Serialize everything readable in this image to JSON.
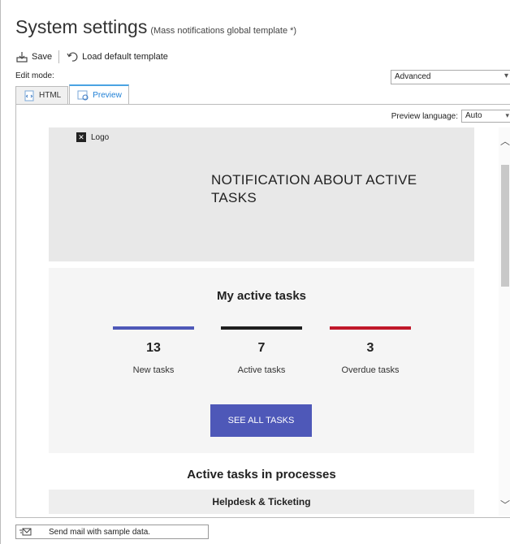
{
  "header": {
    "title": "System settings",
    "subtitle": "(Mass notifications global template *)"
  },
  "toolbar": {
    "save_label": "Save",
    "load_default_label": "Load default template"
  },
  "edit_mode": {
    "label": "Edit mode:",
    "value": "Advanced"
  },
  "tabs": [
    {
      "label": "HTML",
      "active": false
    },
    {
      "label": "Preview",
      "active": true
    }
  ],
  "preview": {
    "language_label": "Preview language:",
    "language_value": "Auto"
  },
  "email": {
    "logo_text": "Logo",
    "heading": "NOTIFICATION ABOUT ACTIVE TASKS",
    "section_title": "My active tasks",
    "stats": [
      {
        "value": "13",
        "label": "New tasks",
        "color": "#4e58b8"
      },
      {
        "value": "7",
        "label": "Active tasks",
        "color": "#1f1f1f"
      },
      {
        "value": "3",
        "label": "Overdue tasks",
        "color": "#c0182a"
      }
    ],
    "cta_label": "SEE ALL TASKS",
    "processes_title": "Active tasks in processes",
    "processes": [
      "Helpdesk & Ticketing"
    ]
  },
  "statusbar": {
    "send_mail_label": "Send mail with sample data."
  },
  "colors": {
    "accent": "#4e58b8",
    "tab_active": "#1e7fd6"
  }
}
